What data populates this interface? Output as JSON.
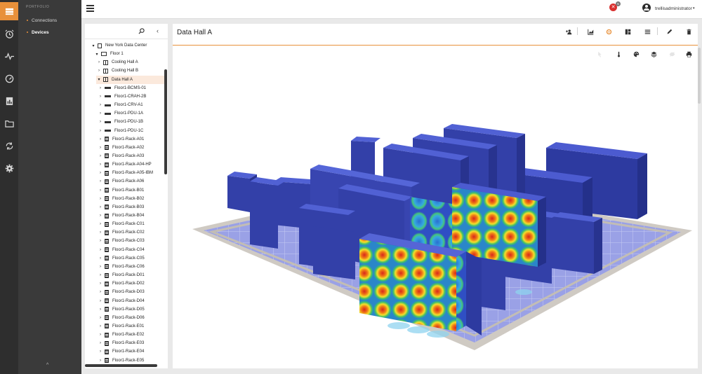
{
  "nav": {
    "section_label": "PORTFOLIO",
    "items": [
      {
        "label": "Connections"
      },
      {
        "label": "Devices"
      }
    ],
    "collapse_glyph": "^"
  },
  "rail": {
    "icons": [
      "dashboard-icon",
      "alarm-clock-icon",
      "pulse-icon",
      "gauge-icon",
      "report-icon",
      "folder-icon",
      "sync-icon",
      "settings-icon"
    ],
    "accent": "#e8903a"
  },
  "header": {
    "alert_glyph": "✕",
    "alert_count": "5",
    "username": "trellisadministrator",
    "user_caret": "▾"
  },
  "tree": {
    "nodes": [
      {
        "label": "New York Data Center",
        "toggle": "▾",
        "icon": "building"
      },
      {
        "label": "Floor 1",
        "toggle": "▾",
        "icon": "floor"
      },
      {
        "label": "Cooling Hall A",
        "toggle": "›",
        "icon": "hall"
      },
      {
        "label": "Cooling Hall B",
        "toggle": "›",
        "icon": "hall"
      },
      {
        "label": "Data Hall A",
        "toggle": "▾",
        "icon": "hall",
        "selected": true
      },
      {
        "label": "Floor1-BCMS-01",
        "toggle": "›",
        "icon": "bar"
      },
      {
        "label": "Floor1-CRAH-2B",
        "toggle": "›",
        "icon": "bar"
      },
      {
        "label": "Floor1-CRV-A1",
        "toggle": "›",
        "icon": "bar"
      },
      {
        "label": "Floor1-PDU-1A",
        "toggle": "›",
        "icon": "bar"
      },
      {
        "label": "Floor1-PDU-1B",
        "toggle": "›",
        "icon": "bar"
      },
      {
        "label": "Floor1-PDU-1C",
        "toggle": "›",
        "icon": "bar"
      },
      {
        "label": "Floor1-Rack-A01",
        "toggle": "›",
        "icon": "rack"
      },
      {
        "label": "Floor1-Rack-A02",
        "toggle": "›",
        "icon": "rack"
      },
      {
        "label": "Floor1-Rack-A03",
        "toggle": "›",
        "icon": "rack"
      },
      {
        "label": "Floor1-Rack-A04-HP",
        "toggle": "›",
        "icon": "rack"
      },
      {
        "label": "Floor1-Rack-A05-IBM",
        "toggle": "›",
        "icon": "rack"
      },
      {
        "label": "Floor1-Rack-A06",
        "toggle": "›",
        "icon": "rack"
      },
      {
        "label": "Floor1-Rack-B01",
        "toggle": "›",
        "icon": "rack"
      },
      {
        "label": "Floor1-Rack-B02",
        "toggle": "›",
        "icon": "rack"
      },
      {
        "label": "Floor1-Rack-B03",
        "toggle": "›",
        "icon": "rack"
      },
      {
        "label": "Floor1-Rack-B04",
        "toggle": "›",
        "icon": "rack"
      },
      {
        "label": "Floor1-Rack-C01",
        "toggle": "›",
        "icon": "rack"
      },
      {
        "label": "Floor1-Rack-C02",
        "toggle": "›",
        "icon": "rack"
      },
      {
        "label": "Floor1-Rack-C03",
        "toggle": "›",
        "icon": "rack"
      },
      {
        "label": "Floor1-Rack-C04",
        "toggle": "›",
        "icon": "rack"
      },
      {
        "label": "Floor1-Rack-C05",
        "toggle": "›",
        "icon": "rack"
      },
      {
        "label": "Floor1-Rack-C06",
        "toggle": "›",
        "icon": "rack"
      },
      {
        "label": "Floor1-Rack-D01",
        "toggle": "›",
        "icon": "rack"
      },
      {
        "label": "Floor1-Rack-D02",
        "toggle": "›",
        "icon": "rack"
      },
      {
        "label": "Floor1-Rack-D03",
        "toggle": "›",
        "icon": "rack"
      },
      {
        "label": "Floor1-Rack-D04",
        "toggle": "›",
        "icon": "rack"
      },
      {
        "label": "Floor1-Rack-D05",
        "toggle": "›",
        "icon": "rack"
      },
      {
        "label": "Floor1-Rack-D06",
        "toggle": "›",
        "icon": "rack"
      },
      {
        "label": "Floor1-Rack-E01",
        "toggle": "›",
        "icon": "rack"
      },
      {
        "label": "Floor1-Rack-E02",
        "toggle": "›",
        "icon": "rack"
      },
      {
        "label": "Floor1-Rack-E03",
        "toggle": "›",
        "icon": "rack"
      },
      {
        "label": "Floor1-Rack-E04",
        "toggle": "›",
        "icon": "rack"
      },
      {
        "label": "Floor1-Rack-E05",
        "toggle": "›",
        "icon": "rack"
      }
    ]
  },
  "main": {
    "title": "Data Hall A",
    "toolbar_icons": [
      "add-user-icon",
      "chart-icon",
      "gear-icon",
      "layout-icon",
      "list-icon",
      "edit-icon",
      "delete-icon"
    ],
    "view_icons": [
      "pointer-icon",
      "thermometer-icon",
      "palette-icon",
      "layers-icon",
      "hide-icon",
      "print-icon"
    ]
  }
}
